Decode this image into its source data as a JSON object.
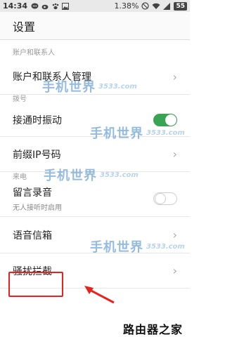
{
  "status_bar": {
    "time": "14:34",
    "battery_percent": "1.38%",
    "battery_level": "55",
    "icons": [
      "chat-bubble-icon",
      "weibo-icon",
      "paw-icon",
      "image-icon",
      "silent-icon",
      "wifi-icon",
      "signal-icon"
    ]
  },
  "app_bar": {
    "title": "设置"
  },
  "sections": {
    "account": "账户和联系人",
    "dial": "拨号",
    "incoming": "来电"
  },
  "rows": {
    "account_manage": "账户和联系人管理",
    "vibrate_on_connect": {
      "label": "接通时振动",
      "enabled": true
    },
    "ip_prefix": "前缀IP号码",
    "voicemail_record": {
      "label": "留言录音",
      "sub": "无人接听时启用",
      "enabled": false
    },
    "voice_mailbox": "语音信箱",
    "harassment_block": "骚扰拦截"
  },
  "watermark": {
    "text": "手机世界",
    "number": "3533.com"
  },
  "footer": {
    "text": "路由器之家"
  },
  "colors": {
    "toggle_on": "#3aa455",
    "highlight": "#e8231d",
    "watermark": "#3f86c7"
  }
}
